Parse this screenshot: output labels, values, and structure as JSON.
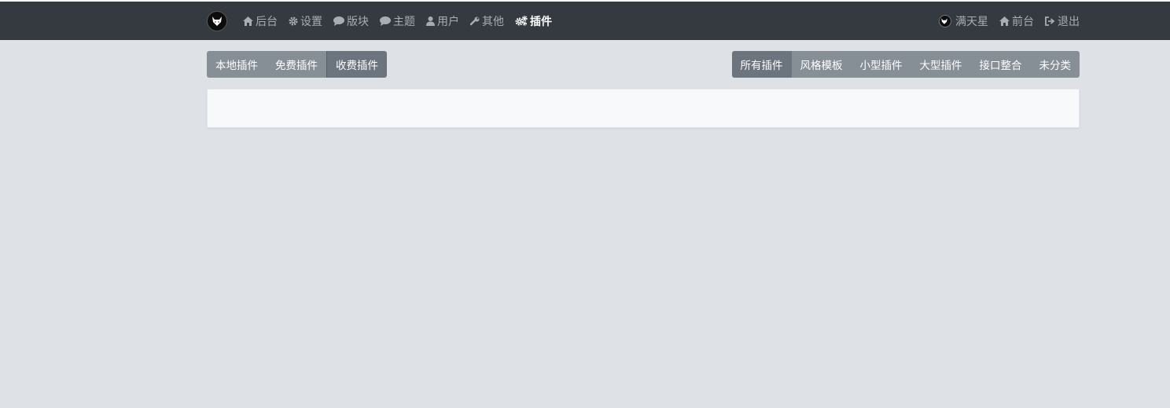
{
  "nav": {
    "left": [
      {
        "id": "backend",
        "label": "后台",
        "icon": "home-icon"
      },
      {
        "id": "settings",
        "label": "设置",
        "icon": "gear-icon"
      },
      {
        "id": "forums",
        "label": "版块",
        "icon": "comment-icon"
      },
      {
        "id": "threads",
        "label": "主题",
        "icon": "comment-icon"
      },
      {
        "id": "users",
        "label": "用户",
        "icon": "user-icon"
      },
      {
        "id": "other",
        "label": "其他",
        "icon": "wrench-icon"
      },
      {
        "id": "plugins",
        "label": "插件",
        "icon": "gears-icon",
        "active": true
      }
    ],
    "right": {
      "user": "满天星",
      "frontend": "前台",
      "logout": "退出"
    }
  },
  "tabs_left": [
    {
      "label": "本地插件",
      "active": false
    },
    {
      "label": "免费插件",
      "active": false
    },
    {
      "label": "收费插件",
      "active": true
    }
  ],
  "tabs_right": [
    {
      "label": "所有插件",
      "active": true
    },
    {
      "label": "风格模板",
      "active": false
    },
    {
      "label": "小型插件",
      "active": false
    },
    {
      "label": "大型插件",
      "active": false
    },
    {
      "label": "接口整合",
      "active": false
    },
    {
      "label": "未分类",
      "active": false
    }
  ],
  "colors": {
    "navbar": "#343a40",
    "background": "#dee2e6",
    "button": "#868e96",
    "button_active": "#6c757d",
    "panel": "#f8f9fa"
  }
}
